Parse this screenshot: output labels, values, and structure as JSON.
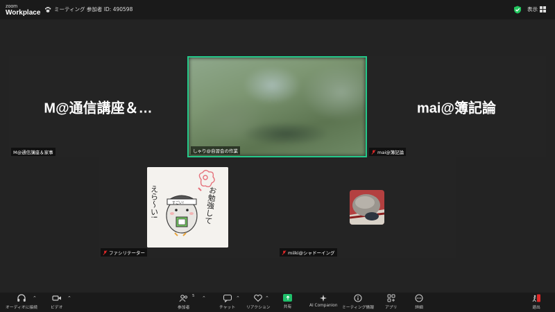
{
  "app": {
    "brand_small": "zoom",
    "brand_large": "Workplace"
  },
  "meeting": {
    "info": "ミーティング 参加者 ID: 490598"
  },
  "view": {
    "label": "表示"
  },
  "tiles": [
    {
      "display_name": "M@通信講座＆…",
      "label": "M@通信講座＆家事"
    },
    {
      "display_name": "",
      "label": "しゃり@自習会の作業"
    },
    {
      "display_name": "mai@簿記論",
      "label": "mai@簿記論"
    },
    {
      "display_name": "",
      "label": "ファシリテーター"
    },
    {
      "display_name": "",
      "label": "miiki@シャドーイング"
    }
  ],
  "sticker": {
    "text_right": "お勉強して",
    "text_left": "えら〜い!",
    "headband": "すごい!"
  },
  "toolbar": {
    "audio": "オーディオに接続",
    "video": "ビデオ",
    "participants": "参加者",
    "participants_count": "5",
    "chat": "チャット",
    "reactions": "リアクション",
    "share": "共有",
    "ai": "AI Companion",
    "info": "ミーティング情報",
    "apps": "アプリ",
    "more": "詳細",
    "leave": "退出"
  },
  "colors": {
    "active_border": "#24c98a",
    "share_green": "#1fbf6a",
    "leave_red": "#e02828",
    "shield_green": "#22c55e"
  }
}
